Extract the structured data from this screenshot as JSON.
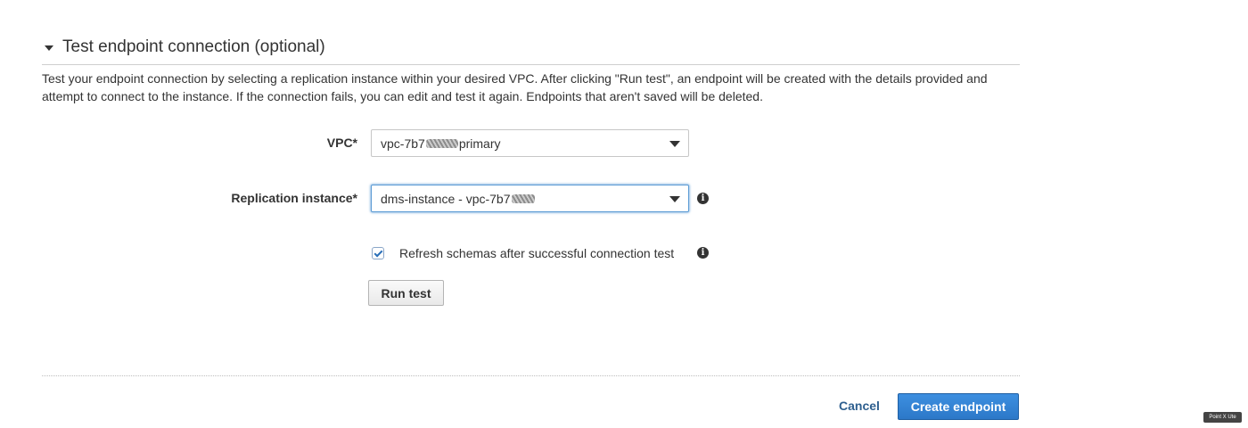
{
  "section": {
    "title": "Test endpoint connection (optional)",
    "description": "Test your endpoint connection by selecting a replication instance within your desired VPC. After clicking \"Run test\", an endpoint will be created with the details provided and attempt to connect to the instance. If the connection fails, you can edit and test it again. Endpoints that aren't saved will be deleted.",
    "collapse_icon": "caret-down-icon"
  },
  "form": {
    "vpc": {
      "label": "VPC*",
      "value_prefix": "vpc-7b7",
      "value_suffix": " primary"
    },
    "replication_instance": {
      "label": "Replication instance*",
      "value_prefix": "dms-instance - vpc-7b7",
      "value_suffix": "",
      "info_icon": "info-icon"
    },
    "refresh_schemas": {
      "label": "Refresh schemas after successful connection test",
      "checked": true,
      "info_icon": "info-icon"
    },
    "run_test_label": "Run test"
  },
  "footer": {
    "cancel_label": "Cancel",
    "create_label": "Create endpoint"
  },
  "watermark": {
    "text": "Point X Ute"
  },
  "colors": {
    "primary_button": "#2c78c8",
    "link": "#2e5f8f",
    "focus_ring": "#5b9bd5",
    "text": "#333333"
  }
}
